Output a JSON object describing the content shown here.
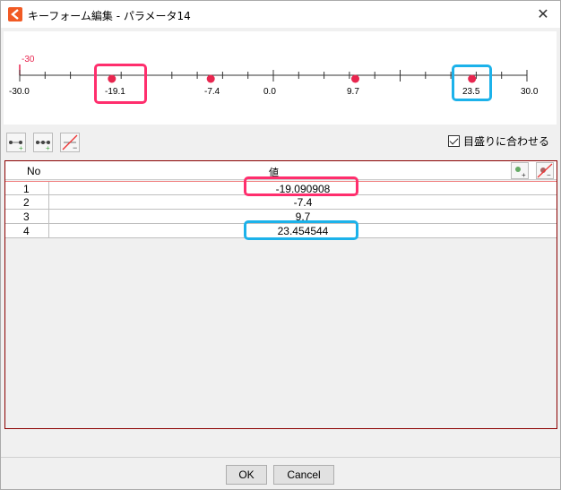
{
  "window": {
    "title": "キーフォーム編集 - パラメータ14"
  },
  "ruler": {
    "min_label": "-30.0",
    "max_label": "30.0",
    "current_value_label": "-30",
    "key_labels": [
      "-19.1",
      "-7.4",
      "0.0",
      "9.7",
      "23.5"
    ],
    "keys": [
      -19.1,
      -7.4,
      9.7,
      23.5
    ],
    "range": [
      -30,
      30
    ],
    "key_color": "#e8264f"
  },
  "toolbar": {
    "snap_label": "目盛りに合わせる",
    "snap_checked": true
  },
  "table": {
    "headers": {
      "no": "No",
      "value": "値"
    },
    "rows": [
      {
        "no": "1",
        "value": "-19.090908"
      },
      {
        "no": "2",
        "value": "-7.4"
      },
      {
        "no": "3",
        "value": "9.7"
      },
      {
        "no": "4",
        "value": "23.454544"
      }
    ]
  },
  "footer": {
    "ok_label": "OK",
    "cancel_label": "Cancel"
  },
  "highlight_colors": {
    "pink": "#ff2e6d",
    "blue": "#1cb2ea"
  }
}
